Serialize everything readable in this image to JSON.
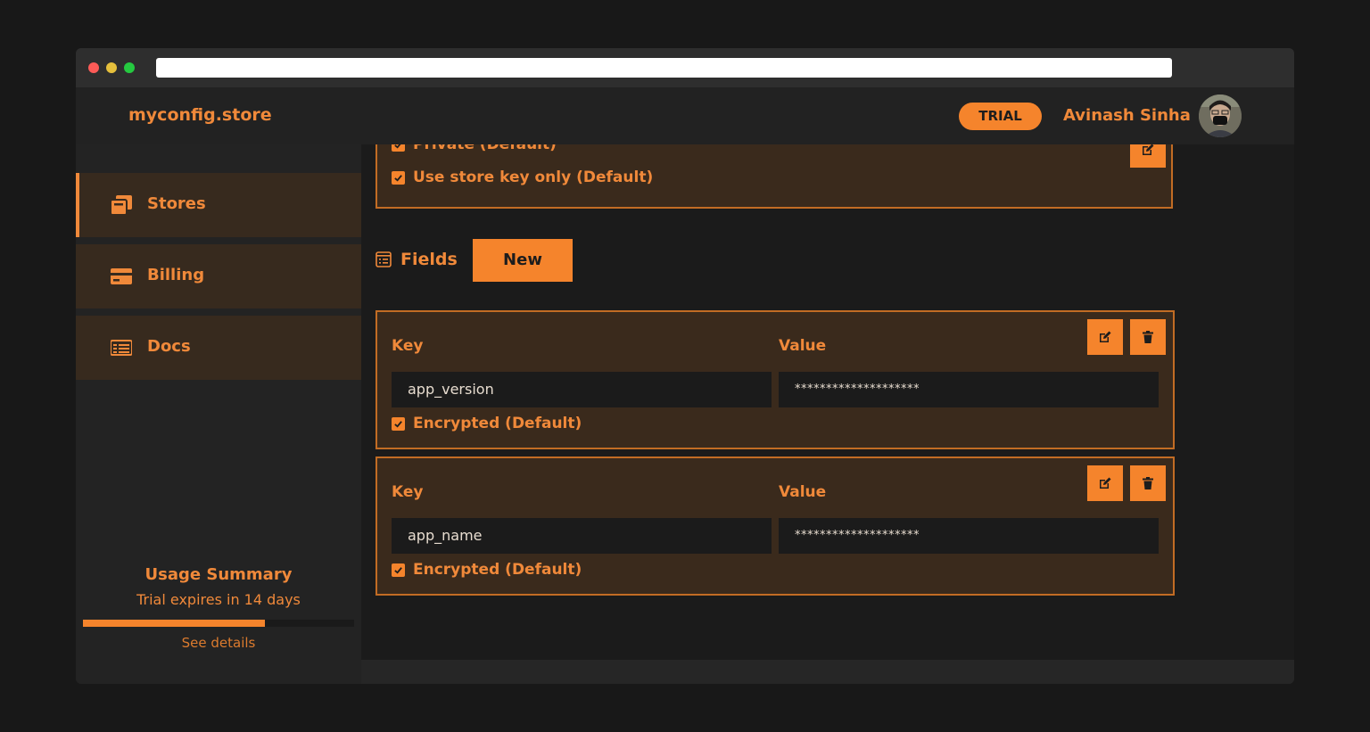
{
  "app": {
    "brand": "myconfig.store",
    "badge": "TRIAL",
    "user_name": "Avinash Sinha"
  },
  "sidebar": {
    "items": [
      {
        "label": "Stores",
        "icon": "stores-icon",
        "active": true
      },
      {
        "label": "Billing",
        "icon": "credit-card-icon",
        "active": false
      },
      {
        "label": "Docs",
        "icon": "docs-icon",
        "active": false
      }
    ],
    "usage": {
      "title": "Usage Summary",
      "subtitle": "Trial expires in 14 days",
      "progress_percent": 67,
      "link": "See details"
    }
  },
  "store_options": {
    "options": [
      {
        "label": "Private (Default)",
        "checked": true
      },
      {
        "label": "Use store key only (Default)",
        "checked": true
      }
    ]
  },
  "fields_section": {
    "title": "Fields",
    "new_label": "New",
    "fields": [
      {
        "key_label": "Key",
        "value_label": "Value",
        "key": "app_version",
        "value": "********************",
        "encrypted_label": "Encrypted (Default)"
      },
      {
        "key_label": "Key",
        "value_label": "Value",
        "key": "app_name",
        "value": "********************",
        "encrypted_label": "Encrypted (Default)"
      }
    ]
  },
  "colors": {
    "accent": "#f5842c",
    "card_bg": "#3a2a1c",
    "card_border": "#c26c24",
    "page_bg": "#1b1b1b"
  }
}
